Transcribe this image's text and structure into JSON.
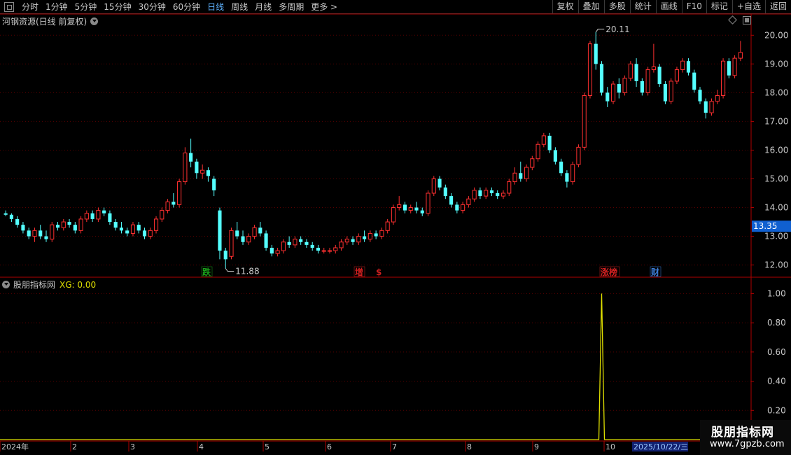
{
  "toolbar": {
    "periods": [
      "分时",
      "1分钟",
      "5分钟",
      "15分钟",
      "30分钟",
      "60分钟",
      "日线",
      "周线",
      "月线",
      "多周期",
      "更多"
    ],
    "active": "日线",
    "more_arrow": ">",
    "right_buttons": [
      "复权",
      "叠加",
      "多股",
      "统计",
      "画线",
      "F10",
      "标记",
      "+自选",
      "返回"
    ]
  },
  "main_chart": {
    "title": "河钢资源(日线 前复权)",
    "y_ticks": [
      "20.00",
      "19.00",
      "18.00",
      "17.00",
      "16.00",
      "15.00",
      "14.00",
      "13.00",
      "12.00"
    ],
    "current_price": "13.35",
    "high_label": "20.11",
    "low_label": "11.88",
    "markers": [
      {
        "text": "跌",
        "color": "#1aa11a"
      },
      {
        "text": "增",
        "color": "#d02020"
      },
      {
        "text": "$",
        "color": "#d02020"
      },
      {
        "text": "涨榜",
        "color": "#d02020"
      },
      {
        "text": "财",
        "color": "#3d7dd6"
      }
    ],
    "colors": {
      "up": "#ff3030",
      "down": "#54ffff",
      "axis": "#b00000",
      "grid": "#5a0000"
    }
  },
  "indicator": {
    "name": "股朋指标网",
    "value_label": "XG: 0.00",
    "y_ticks": [
      "1.00",
      "0.80",
      "0.60",
      "0.40",
      "0.20"
    ],
    "line_color": "#e0e000"
  },
  "time_axis": {
    "labels": [
      "2024年",
      "2",
      "3",
      "4",
      "5",
      "6",
      "7",
      "8",
      "9",
      "10"
    ],
    "cursor_date": "2025/10/22/三"
  },
  "watermark": {
    "line1": "股朋指标网",
    "line2": "www.7gpzb.com"
  },
  "chart_data": {
    "type": "candlestick",
    "price_range": [
      11.6,
      20.3
    ],
    "ohlc": [
      [
        13.8,
        13.9,
        13.7,
        13.75
      ],
      [
        13.75,
        13.8,
        13.5,
        13.6
      ],
      [
        13.6,
        13.7,
        13.3,
        13.4
      ],
      [
        13.4,
        13.5,
        13.1,
        13.2
      ],
      [
        13.2,
        13.3,
        12.9,
        13.0
      ],
      [
        13.0,
        13.3,
        12.8,
        13.2
      ],
      [
        13.2,
        13.4,
        12.9,
        13.0
      ],
      [
        13.0,
        13.2,
        12.8,
        12.9
      ],
      [
        12.9,
        13.5,
        12.8,
        13.4
      ],
      [
        13.4,
        13.5,
        13.2,
        13.3
      ],
      [
        13.3,
        13.6,
        13.2,
        13.5
      ],
      [
        13.5,
        13.6,
        13.3,
        13.4
      ],
      [
        13.4,
        13.5,
        13.1,
        13.2
      ],
      [
        13.2,
        13.7,
        13.1,
        13.6
      ],
      [
        13.6,
        13.9,
        13.5,
        13.8
      ],
      [
        13.8,
        13.9,
        13.5,
        13.6
      ],
      [
        13.6,
        14.0,
        13.5,
        13.9
      ],
      [
        13.9,
        14.0,
        13.7,
        13.8
      ],
      [
        13.8,
        13.9,
        13.4,
        13.5
      ],
      [
        13.5,
        13.6,
        13.2,
        13.3
      ],
      [
        13.3,
        13.5,
        13.1,
        13.2
      ],
      [
        13.2,
        13.3,
        13.0,
        13.1
      ],
      [
        13.1,
        13.5,
        13.0,
        13.4
      ],
      [
        13.4,
        13.5,
        13.1,
        13.2
      ],
      [
        13.2,
        13.3,
        12.9,
        13.0
      ],
      [
        13.0,
        13.3,
        12.9,
        13.2
      ],
      [
        13.2,
        13.7,
        13.1,
        13.6
      ],
      [
        13.6,
        14.0,
        13.5,
        13.9
      ],
      [
        13.9,
        14.3,
        13.8,
        14.2
      ],
      [
        14.2,
        14.5,
        14.0,
        14.1
      ],
      [
        14.1,
        15.0,
        14.0,
        14.9
      ],
      [
        14.9,
        16.1,
        14.8,
        15.9
      ],
      [
        15.9,
        16.4,
        15.4,
        15.6
      ],
      [
        15.6,
        15.7,
        15.0,
        15.2
      ],
      [
        15.2,
        15.5,
        15.0,
        15.3
      ],
      [
        15.3,
        15.4,
        14.9,
        15.1
      ],
      [
        15.0,
        15.1,
        14.4,
        14.6
      ],
      [
        13.9,
        14.0,
        12.2,
        12.5
      ],
      [
        12.5,
        12.6,
        11.88,
        12.2
      ],
      [
        12.3,
        13.3,
        12.2,
        13.2
      ],
      [
        13.2,
        13.5,
        12.9,
        13.0
      ],
      [
        13.0,
        13.2,
        12.7,
        12.8
      ],
      [
        12.8,
        13.1,
        12.7,
        13.0
      ],
      [
        13.0,
        13.4,
        12.9,
        13.3
      ],
      [
        13.3,
        13.5,
        13.0,
        13.1
      ],
      [
        13.1,
        13.2,
        12.5,
        12.6
      ],
      [
        12.6,
        12.7,
        12.3,
        12.4
      ],
      [
        12.4,
        12.6,
        12.3,
        12.5
      ],
      [
        12.5,
        12.9,
        12.4,
        12.8
      ],
      [
        12.8,
        13.0,
        12.6,
        12.7
      ],
      [
        12.7,
        13.0,
        12.6,
        12.9
      ],
      [
        12.9,
        13.0,
        12.7,
        12.8
      ],
      [
        12.8,
        12.9,
        12.6,
        12.7
      ],
      [
        12.7,
        12.8,
        12.5,
        12.6
      ],
      [
        12.6,
        12.7,
        12.4,
        12.5
      ],
      [
        12.5,
        12.6,
        12.4,
        12.5
      ],
      [
        12.5,
        12.6,
        12.4,
        12.5
      ],
      [
        12.5,
        12.7,
        12.4,
        12.6
      ],
      [
        12.6,
        12.9,
        12.5,
        12.8
      ],
      [
        12.8,
        13.0,
        12.7,
        12.9
      ],
      [
        12.9,
        13.0,
        12.7,
        12.8
      ],
      [
        12.8,
        13.1,
        12.7,
        13.0
      ],
      [
        13.0,
        13.2,
        12.8,
        12.9
      ],
      [
        12.9,
        13.2,
        12.8,
        13.1
      ],
      [
        13.1,
        13.2,
        12.9,
        13.0
      ],
      [
        13.0,
        13.3,
        12.9,
        13.2
      ],
      [
        13.2,
        13.6,
        13.1,
        13.5
      ],
      [
        13.5,
        14.1,
        13.4,
        14.0
      ],
      [
        14.0,
        14.4,
        13.9,
        14.1
      ],
      [
        14.1,
        14.2,
        13.8,
        13.9
      ],
      [
        13.9,
        14.1,
        13.8,
        14.0
      ],
      [
        14.0,
        14.2,
        13.8,
        13.9
      ],
      [
        13.9,
        14.0,
        13.7,
        13.8
      ],
      [
        13.8,
        14.6,
        13.7,
        14.5
      ],
      [
        14.5,
        15.1,
        14.4,
        15.0
      ],
      [
        15.0,
        15.1,
        14.6,
        14.7
      ],
      [
        14.7,
        14.8,
        14.3,
        14.4
      ],
      [
        14.4,
        14.5,
        14.0,
        14.1
      ],
      [
        14.1,
        14.2,
        13.8,
        13.9
      ],
      [
        13.9,
        14.2,
        13.8,
        14.1
      ],
      [
        14.1,
        14.4,
        14.0,
        14.3
      ],
      [
        14.3,
        14.7,
        14.2,
        14.6
      ],
      [
        14.6,
        14.7,
        14.3,
        14.4
      ],
      [
        14.4,
        14.7,
        14.3,
        14.6
      ],
      [
        14.6,
        14.7,
        14.4,
        14.5
      ],
      [
        14.5,
        14.6,
        14.3,
        14.4
      ],
      [
        14.4,
        14.6,
        14.3,
        14.5
      ],
      [
        14.5,
        15.0,
        14.4,
        14.9
      ],
      [
        14.9,
        15.4,
        14.8,
        15.2
      ],
      [
        15.2,
        15.6,
        14.9,
        15.0
      ],
      [
        15.0,
        15.5,
        14.9,
        15.4
      ],
      [
        15.4,
        15.8,
        15.3,
        15.7
      ],
      [
        15.7,
        16.3,
        15.6,
        16.2
      ],
      [
        16.2,
        16.6,
        16.1,
        16.5
      ],
      [
        16.5,
        16.6,
        15.9,
        16.0
      ],
      [
        16.0,
        16.1,
        15.5,
        15.6
      ],
      [
        15.6,
        15.7,
        15.1,
        15.2
      ],
      [
        15.2,
        15.3,
        14.7,
        14.9
      ],
      [
        14.9,
        15.6,
        14.8,
        15.5
      ],
      [
        15.5,
        16.2,
        15.4,
        16.1
      ],
      [
        16.1,
        18.0,
        16.0,
        17.9
      ],
      [
        17.9,
        19.8,
        17.8,
        19.7
      ],
      [
        19.7,
        20.11,
        18.8,
        19.0
      ],
      [
        19.0,
        19.1,
        17.9,
        18.0
      ],
      [
        18.0,
        18.2,
        17.5,
        17.7
      ],
      [
        17.7,
        18.4,
        17.6,
        18.3
      ],
      [
        18.3,
        18.5,
        17.8,
        18.0
      ],
      [
        18.0,
        18.6,
        17.9,
        18.5
      ],
      [
        18.5,
        19.1,
        18.4,
        19.0
      ],
      [
        19.0,
        19.2,
        18.2,
        18.4
      ],
      [
        18.4,
        18.5,
        17.9,
        18.0
      ],
      [
        18.0,
        18.9,
        17.9,
        18.8
      ],
      [
        18.8,
        19.7,
        18.7,
        18.9
      ],
      [
        18.9,
        19.0,
        18.2,
        18.3
      ],
      [
        18.3,
        18.4,
        17.6,
        17.7
      ],
      [
        17.7,
        18.5,
        17.6,
        18.4
      ],
      [
        18.4,
        18.9,
        18.3,
        18.8
      ],
      [
        18.8,
        19.2,
        18.7,
        19.1
      ],
      [
        19.1,
        19.2,
        18.6,
        18.7
      ],
      [
        18.7,
        18.8,
        18.0,
        18.1
      ],
      [
        18.1,
        18.2,
        17.6,
        17.7
      ],
      [
        17.7,
        17.8,
        17.1,
        17.3
      ],
      [
        17.3,
        17.8,
        17.2,
        17.7
      ],
      [
        17.7,
        18.1,
        17.6,
        17.9
      ],
      [
        17.9,
        19.2,
        17.8,
        19.1
      ],
      [
        19.1,
        19.2,
        18.5,
        18.6
      ],
      [
        18.6,
        19.3,
        18.5,
        19.2
      ],
      [
        19.2,
        19.8,
        19.1,
        19.4
      ]
    ],
    "high_value": 20.11,
    "low_value": 11.88,
    "last_price": 13.35,
    "indicator_series": {
      "name": "XG",
      "range": [
        0,
        1.05
      ],
      "spike_bar_index": 103,
      "spike_value": 1.0,
      "baseline": 0
    }
  }
}
